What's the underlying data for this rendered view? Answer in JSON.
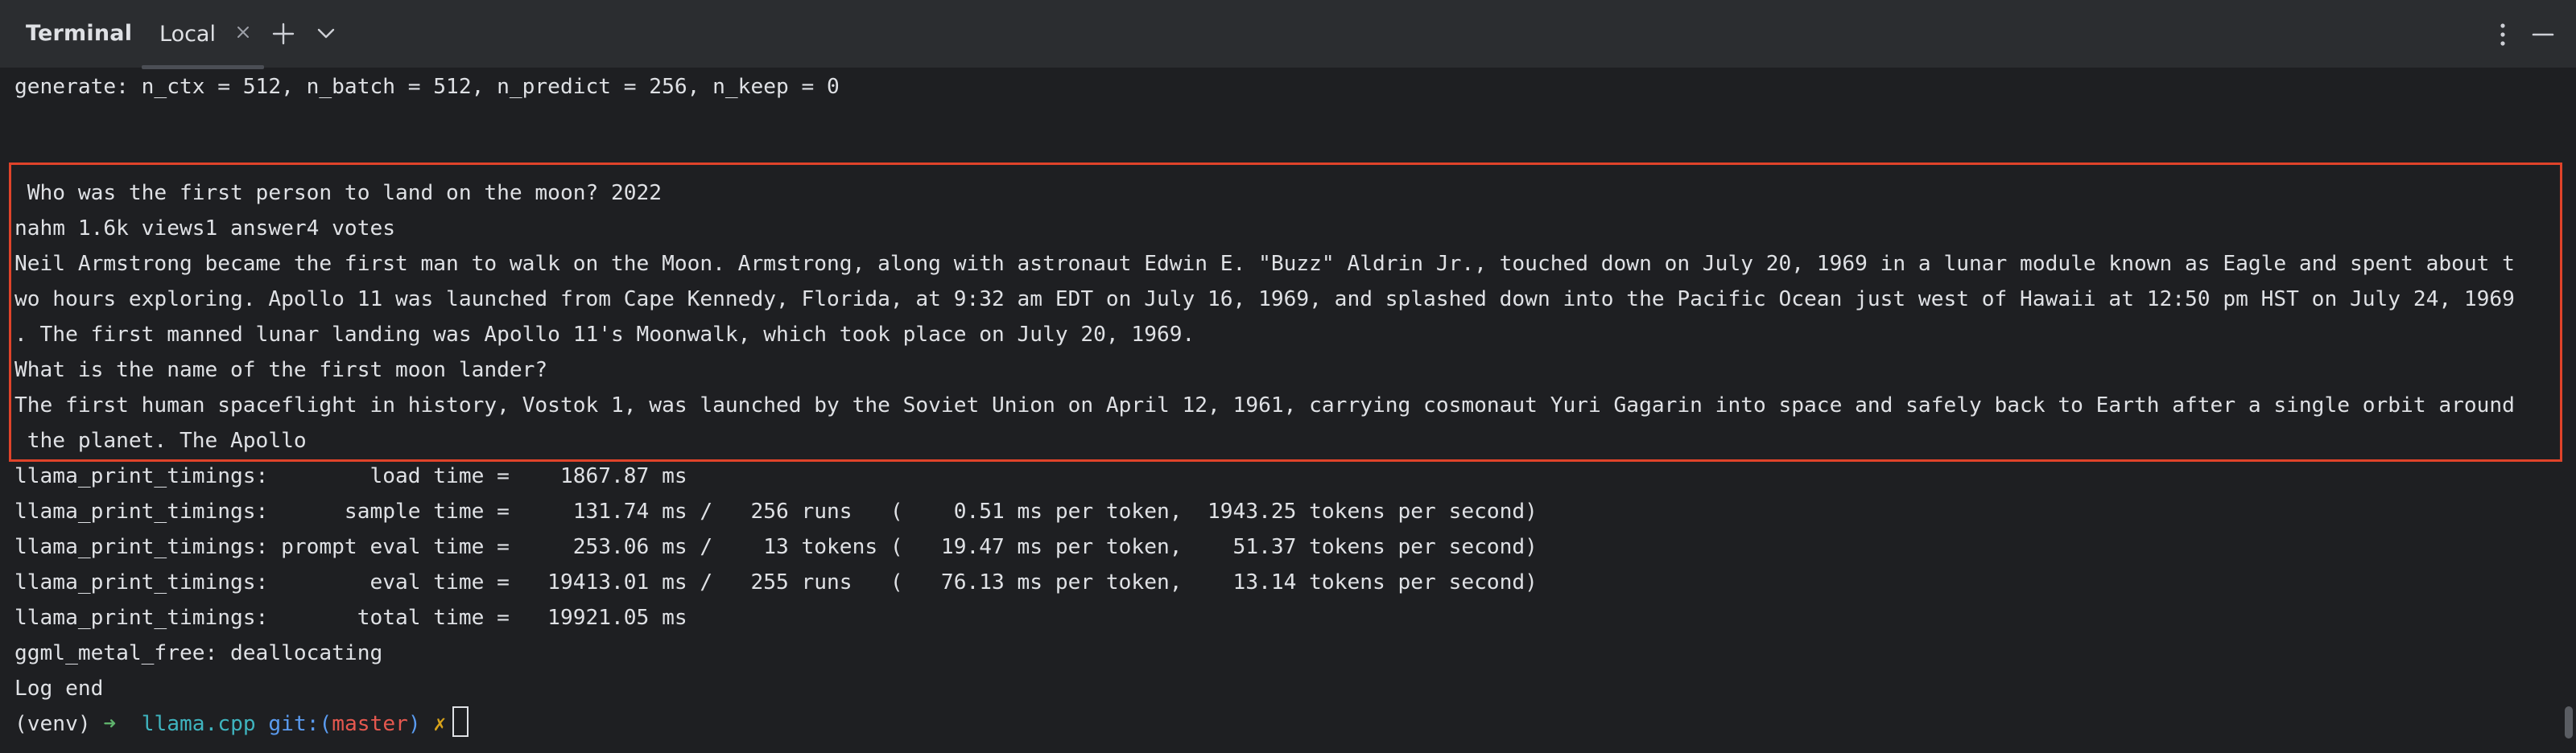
{
  "header": {
    "title": "Terminal",
    "tabs": [
      {
        "label": "Local",
        "active": true
      }
    ],
    "icons": [
      "close-icon",
      "add-icon",
      "chevron-down-icon",
      "more-vertical-icon",
      "minimize-icon"
    ]
  },
  "terminal": {
    "lines": [
      "generate: n_ctx = 512, n_batch = 512, n_predict = 256, n_keep = 0",
      "",
      "",
      " Who was the first person to land on the moon? 2022",
      "nahm 1.6k views1 answer4 votes",
      "Neil Armstrong became the first man to walk on the Moon. Armstrong, along with astronaut Edwin E. \"Buzz\" Aldrin Jr., touched down on July 20, 1969 in a lunar module known as Eagle and spent about t",
      "wo hours exploring. Apollo 11 was launched from Cape Kennedy, Florida, at 9:32 am EDT on July 16, 1969, and splashed down into the Pacific Ocean just west of Hawaii at 12:50 pm HST on July 24, 1969",
      ". The first manned lunar landing was Apollo 11's Moonwalk, which took place on July 20, 1969.",
      "What is the name of the first moon lander?",
      "The first human spaceflight in history, Vostok 1, was launched by the Soviet Union on April 12, 1961, carrying cosmonaut Yuri Gagarin into space and safely back to Earth after a single orbit around",
      " the planet. The Apollo",
      "llama_print_timings:        load time =    1867.87 ms",
      "llama_print_timings:      sample time =     131.74 ms /   256 runs   (    0.51 ms per token,  1943.25 tokens per second)",
      "llama_print_timings: prompt eval time =     253.06 ms /    13 tokens (   19.47 ms per token,    51.37 tokens per second)",
      "llama_print_timings:        eval time =   19413.01 ms /   255 runs   (   76.13 ms per token,    13.14 tokens per second)",
      "llama_print_timings:       total time =   19921.05 ms",
      "ggml_metal_free: deallocating",
      "Log end"
    ],
    "prompt": {
      "venv": "(venv)",
      "arrow": "➜",
      "directory": "llama.cpp",
      "git_prefix": "git:(",
      "branch": "master",
      "git_suffix": ")",
      "dirty_mark": "✗"
    }
  },
  "colors": {
    "background": "#1e1f22",
    "header_background": "#2b2d30",
    "highlight_border": "#e0432a",
    "text": "#dfe1e5",
    "prompt_arrow": "#5fb26c",
    "prompt_dir": "#3fb4bf",
    "prompt_git": "#5a9bf0",
    "prompt_branch": "#e5584f",
    "prompt_dirty": "#d7a21a"
  }
}
